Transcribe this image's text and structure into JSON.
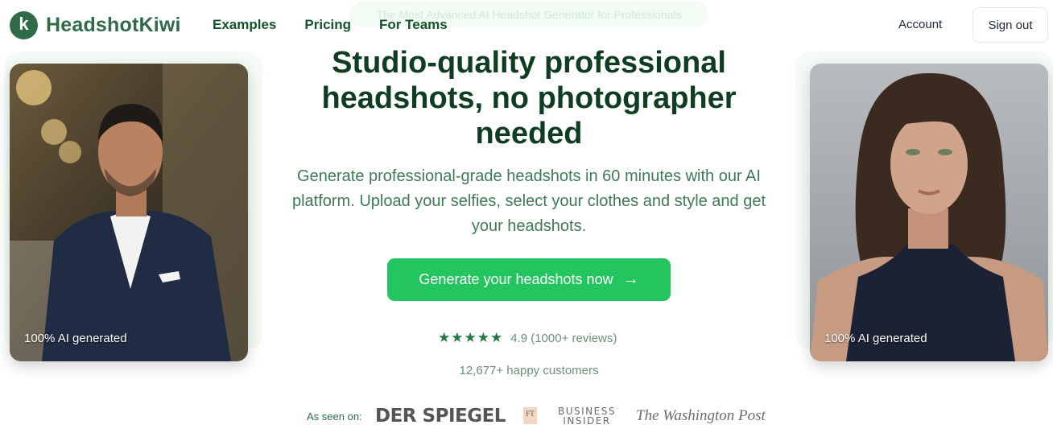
{
  "header": {
    "logo_letter": "k",
    "logo_text": "HeadshotKiwi",
    "nav": [
      "Examples",
      "Pricing",
      "For Teams"
    ],
    "tagline": "The Most Advanced AI Headshot Generator for Professionals",
    "account_label": "Account",
    "signout_label": "Sign out"
  },
  "hero": {
    "title": "Studio-quality professional headshots, no photographer needed",
    "subtitle": "Generate professional-grade headshots in 60 minutes with our AI platform. Upload your selfies, select your clothes and style and get your headshots.",
    "cta_label": "Generate your headshots now",
    "cta_icon": "arrow-right-icon",
    "stars": "★★★★★",
    "rating_text": "4.9 (1000+ reviews)",
    "customers_text": "12,677+ happy customers"
  },
  "photos": {
    "left_caption": "100% AI generated",
    "right_caption": "100% AI generated"
  },
  "press": {
    "label": "As seen on:",
    "spiegel": "DER SPIEGEL",
    "ft": "FT",
    "bi_line1": "BUSINESS",
    "bi_line2": "INSIDER",
    "wp": "The Washington Post"
  },
  "colors": {
    "brand": "#2f6b47",
    "cta": "#22c55e",
    "title": "#0f3d22"
  }
}
